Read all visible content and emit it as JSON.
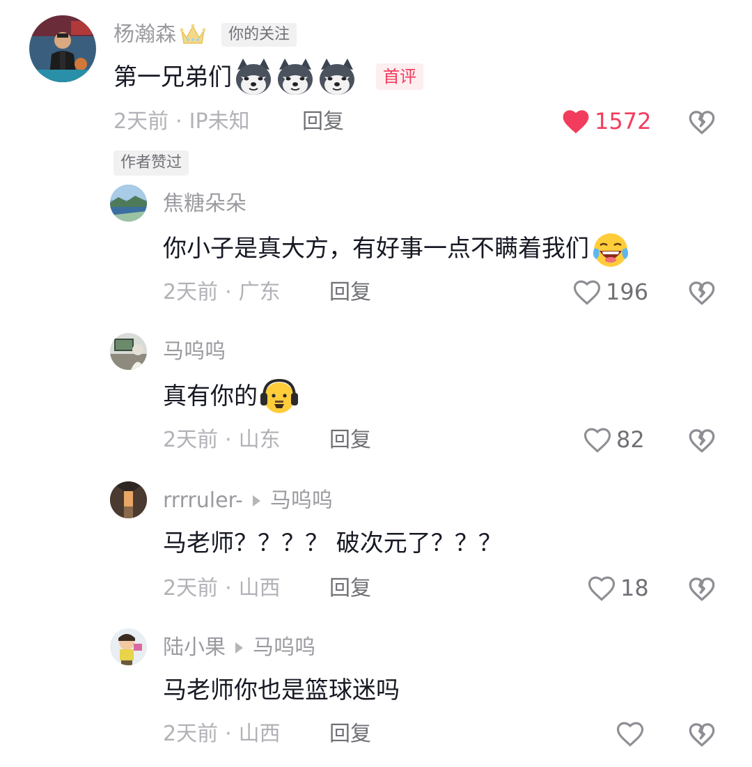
{
  "comments": [
    {
      "username": "杨瀚森",
      "follow_tag": "你的关注",
      "text": "第一兄弟们",
      "emojis": [
        "husky-emoji",
        "husky-emoji",
        "husky-emoji"
      ],
      "first_tag": "首评",
      "time": "2天前",
      "location": "IP未知",
      "reply_label": "回复",
      "likes": "1572",
      "liked": true,
      "author_liked_tag": "作者赞过"
    },
    {
      "username": "焦糖朵朵",
      "text": "你小子是真大方，有好事一点不瞒着我们",
      "emojis": [
        "laugh-cry-emoji"
      ],
      "time": "2天前",
      "location": "广东",
      "reply_label": "回复",
      "likes": "196"
    },
    {
      "username": "马呜呜",
      "text": "真有你的",
      "emojis": [
        "headphones-face-emoji"
      ],
      "time": "2天前",
      "location": "山东",
      "reply_label": "回复",
      "likes": "82"
    },
    {
      "username": "rrrruler-",
      "reply_to": "马呜呜",
      "text": "马老师？？？？ 破次元了？？？",
      "time": "2天前",
      "location": "山西",
      "reply_label": "回复",
      "likes": "18"
    },
    {
      "username": "陆小果",
      "reply_to": "马呜呜",
      "text": "马老师你也是篮球迷吗",
      "time": "2天前",
      "location": "山西",
      "reply_label": "回复",
      "likes": ""
    }
  ],
  "meta_separator": "·",
  "colors": {
    "like_red": "#f23c5d",
    "muted": "#b1b2b7",
    "text": "#161823"
  }
}
